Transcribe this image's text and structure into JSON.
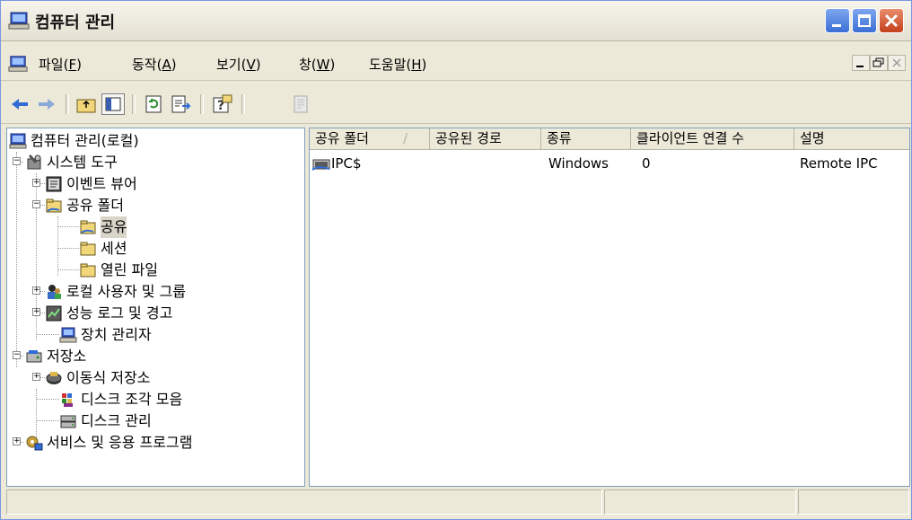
{
  "window": {
    "title": "컴퓨터 관리"
  },
  "menu": [
    {
      "label": "파일(",
      "key": "F",
      "suffix": ")"
    },
    {
      "label": "동작(",
      "key": "A",
      "suffix": ")"
    },
    {
      "label": "보기(",
      "key": "V",
      "suffix": ")"
    },
    {
      "label": "창(",
      "key": "W",
      "suffix": ")"
    },
    {
      "label": "도움말(",
      "key": "H",
      "suffix": ")"
    }
  ],
  "tree": {
    "root": "컴퓨터 관리(로컬)",
    "system_tools": "시스템 도구",
    "event_viewer": "이벤트 뷰어",
    "shared_folders": "공유 폴더",
    "shares": "공유",
    "sessions": "세션",
    "open_files": "열린 파일",
    "local_users": "로컬 사용자 및 그룹",
    "perf_logs": "성능 로그 및 경고",
    "device_manager": "장치 관리자",
    "storage": "저장소",
    "removable_storage": "이동식 저장소",
    "defrag": "디스크 조각 모음",
    "disk_management": "디스크 관리",
    "services_apps": "서비스 및 응용 프로그램"
  },
  "list": {
    "columns": [
      "공유 폴더",
      "공유된 경로",
      "종류",
      "클라이언트 연결 수",
      "설명"
    ],
    "sort_indicator": "/",
    "rows": [
      {
        "share": "IPC$",
        "path": "",
        "type": "Windows",
        "connections": "0",
        "description": "Remote IPC"
      }
    ]
  },
  "colors": {
    "title_bg": "#ece9d8",
    "selection": "#d8d4c8",
    "pane_border": "#7f9db9"
  }
}
